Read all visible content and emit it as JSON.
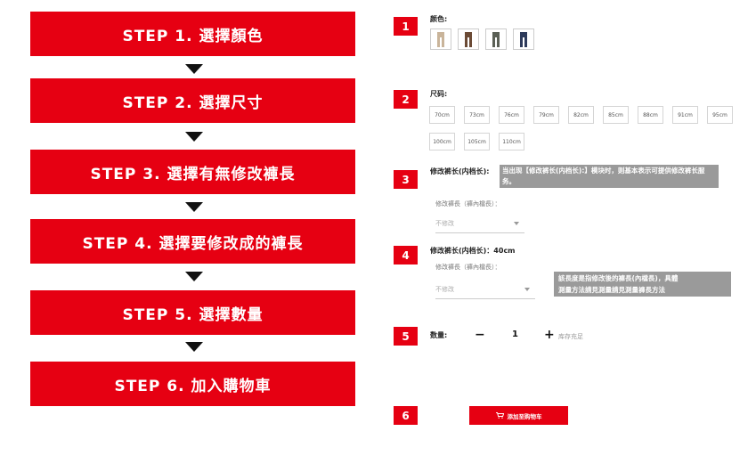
{
  "steps": [
    {
      "label": "STEP 1. 選擇顏色"
    },
    {
      "label": "STEP 2. 選擇尺寸"
    },
    {
      "label": "STEP 3. 選擇有無修改褲長"
    },
    {
      "label": "STEP 4. 選擇要修改成的褲長"
    },
    {
      "label": "STEP 5. 選擇數量"
    },
    {
      "label": "STEP 6. 加入購物車"
    }
  ],
  "badges": [
    "1",
    "2",
    "3",
    "4",
    "5",
    "6"
  ],
  "color_section": {
    "label": "颜色:",
    "swatches": [
      {
        "name": "beige",
        "color": "#c9b49a"
      },
      {
        "name": "brown",
        "color": "#6b4a35"
      },
      {
        "name": "olive",
        "color": "#5a5f55"
      },
      {
        "name": "navy",
        "color": "#2d3a5a"
      }
    ]
  },
  "size_section": {
    "label": "尺码:",
    "sizes": [
      "70cm",
      "73cm",
      "76cm",
      "79cm",
      "82cm",
      "85cm",
      "88cm",
      "91cm",
      "95cm",
      "100cm",
      "105cm",
      "110cm"
    ]
  },
  "hem_section": {
    "label": "修改裤长(内档长):",
    "note": "当出现【修改裤长(内档长):】模块时，则基本表示可提供修改裤长服务。",
    "sub_label": "修改褲長（褲內檔長）：",
    "select_value": "不修改"
  },
  "hem_length_section": {
    "label": "修改裤长(内档长)：40cm",
    "sub_label": "修改褲長（褲內檔長）：",
    "select_value": "不修改",
    "note_line1": "該長度是指修改後的褲長(內檔長)，具體",
    "note_line2": "測量方法請見測量請見測量褲長方法"
  },
  "qty_section": {
    "label": "数量:",
    "minus": "−",
    "value": "1",
    "plus": "+",
    "stock": "库存充足"
  },
  "cart": {
    "label": "添加至购物车"
  },
  "colors": {
    "accent": "#e60012",
    "note_bg": "#9a9a9a"
  }
}
